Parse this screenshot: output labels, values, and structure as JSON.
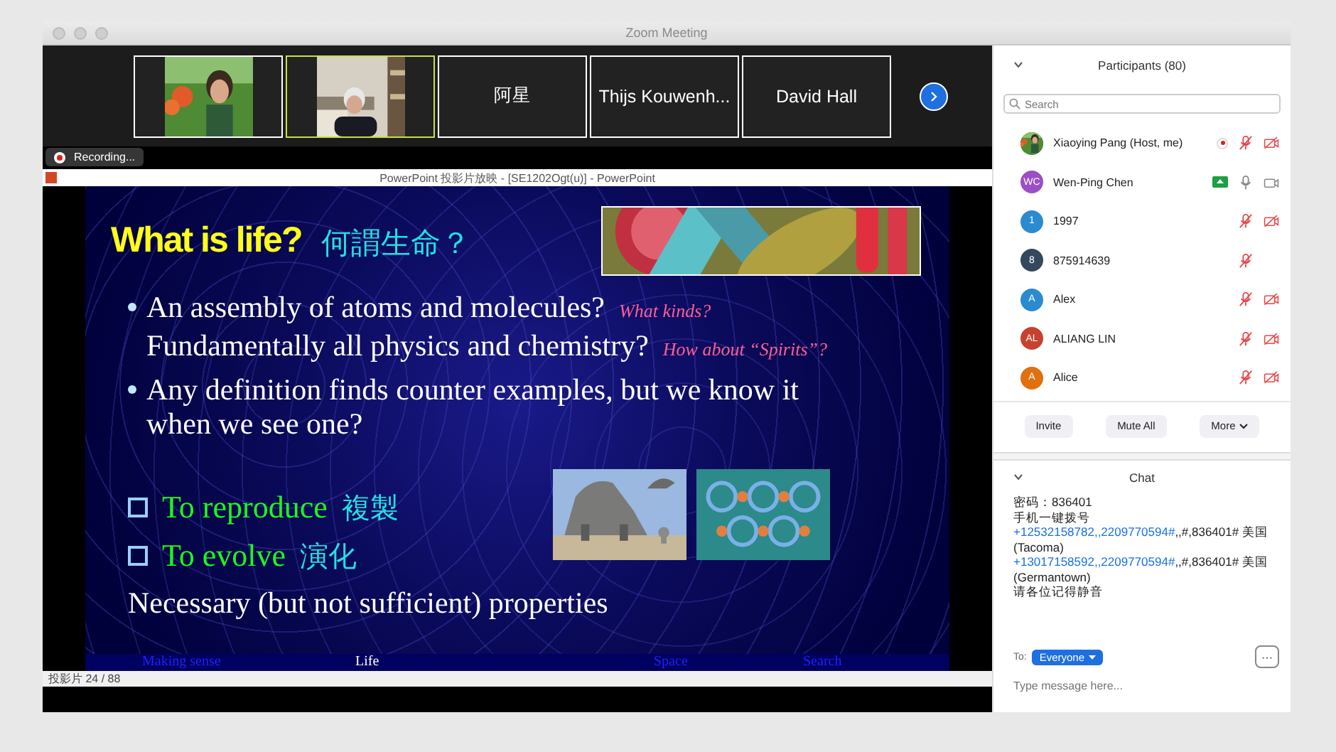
{
  "window": {
    "title": "Zoom Meeting"
  },
  "gallery": {
    "tiles": [
      {
        "kind": "picture",
        "speaking": false
      },
      {
        "kind": "picture",
        "speaking": true
      },
      {
        "kind": "name",
        "name": "阿星",
        "speaking": false
      },
      {
        "kind": "name",
        "name": "Thijs Kouwenh...",
        "speaking": false
      },
      {
        "kind": "name",
        "name": "David Hall",
        "speaking": false
      }
    ]
  },
  "recording": {
    "label": "Recording..."
  },
  "presentation": {
    "title": "PowerPoint 投影片放映 - [SE1202Ogt(u)] - PowerPoint",
    "status": "投影片 24 / 88",
    "slide": {
      "title": "What is life?",
      "title_cn": "何謂生命？",
      "bullets": [
        {
          "lines": [
            {
              "text": "An assembly of atoms and molecules?",
              "note": "What kinds?"
            },
            {
              "text": "Fundamentally all physics and chemistry?",
              "note": "How about “Spirits”?"
            }
          ]
        },
        {
          "lines": [
            {
              "text": "Any definition finds counter examples, but we know it"
            },
            {
              "text": "when we see one?"
            }
          ]
        }
      ],
      "checklist": [
        {
          "text": "To reproduce",
          "cn": "複製",
          "checked": false
        },
        {
          "text": "To evolve",
          "cn": "演化",
          "checked": false
        }
      ],
      "footer": "Necessary (but not sufficient) properties",
      "nav": [
        {
          "label": "Making sense",
          "selected": false
        },
        {
          "label": "Life",
          "selected": true
        },
        {
          "label": "Space",
          "selected": false
        },
        {
          "label": "Search",
          "selected": false
        }
      ]
    }
  },
  "participants": {
    "title": "Participants (80)",
    "search": {
      "placeholder": "Search"
    },
    "items": [
      {
        "name": "Xiaoying Pang (Host, me)",
        "kind": "picture",
        "recording": true,
        "sharing": false,
        "muted": true,
        "video_off": true
      },
      {
        "name": "Wen-Ping Chen",
        "kind": "initials",
        "initials": "WC",
        "color": "#9b4fc4",
        "recording": false,
        "sharing": true,
        "muted": false,
        "video_off": false
      },
      {
        "name": "1997",
        "kind": "initials",
        "initials": "1",
        "color": "#2a8bd0",
        "recording": false,
        "sharing": false,
        "muted": true,
        "video_off": true
      },
      {
        "name": "875914639",
        "kind": "initials",
        "initials": "8",
        "color": "#34495e",
        "recording": false,
        "sharing": false,
        "muted": true
      },
      {
        "name": "Alex",
        "kind": "initials",
        "initials": "A",
        "color": "#2a8bd0",
        "recording": false,
        "sharing": false,
        "muted": true,
        "video_off": true
      },
      {
        "name": "ALIANG LIN",
        "kind": "initials",
        "initials": "AL",
        "color": "#c8412e",
        "recording": false,
        "sharing": false,
        "muted": true,
        "video_off": true
      },
      {
        "name": "Alice",
        "kind": "initials",
        "initials": "A",
        "color": "#e0700f",
        "recording": false,
        "sharing": false,
        "muted": true,
        "video_off": true
      }
    ],
    "buttons": [
      {
        "label": "Invite",
        "kind": "plain"
      },
      {
        "label": "Mute All",
        "kind": "plain"
      },
      {
        "label": "More",
        "kind": "menu"
      }
    ]
  },
  "chat": {
    "title": "Chat",
    "messages": [
      {
        "text": "密码：836401"
      },
      {
        "text": "手机一键拨号"
      },
      {
        "link": "+12532158782,,2209770594#",
        "text": ",,#,836401# 美国 (Tacoma)"
      },
      {
        "link": "+13017158592,,2209770594#",
        "text": ",,#,836401# 美国 (Germantown)"
      },
      {
        "text": "请各位记得静音"
      }
    ],
    "to_label": "To:",
    "recipient": "Everyone",
    "more": "···",
    "input": {
      "placeholder": "Type message here..."
    }
  }
}
